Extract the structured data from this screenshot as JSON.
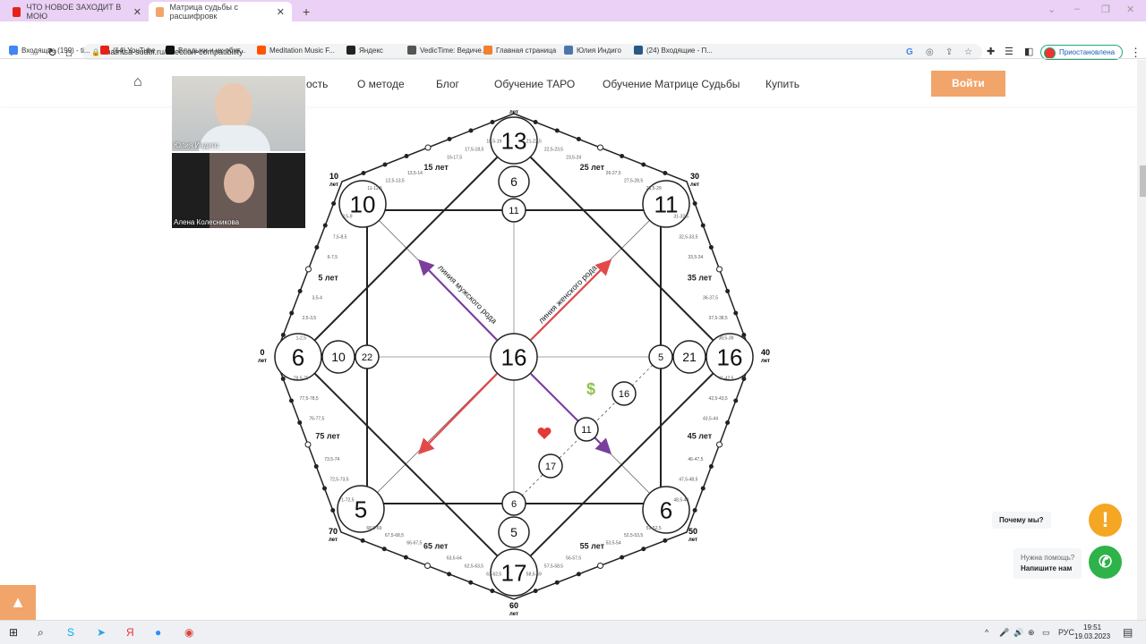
{
  "browser": {
    "tabs": [
      {
        "title": "ЧТО НОВОЕ ЗАХОДИТ В МОЮ",
        "icon": "youtube-icon",
        "color": "#e62117"
      },
      {
        "title": "Матрица судьбы с расшифровк",
        "icon": "site-icon",
        "color": "#f2a56b",
        "active": true
      }
    ],
    "new_tab": "+",
    "url": "matritsa-sudbi.ru/#section-compatibility",
    "profile_status": "Приостановлена",
    "bookmarks": [
      {
        "label": "Входящие (199) - ti...",
        "icon": "gmail-icon",
        "color": "#4285f4"
      },
      {
        "label": "(14) YouTube",
        "icon": "youtube-icon",
        "color": "#e62117"
      },
      {
        "label": "Владыки и их обит...",
        "icon": "t-icon",
        "color": "#111"
      },
      {
        "label": "Meditation Music F...",
        "icon": "soundcloud-icon",
        "color": "#f50"
      },
      {
        "label": "Яндекс",
        "icon": "globe-icon",
        "color": "#222"
      },
      {
        "label": "VedicTime: Ведиче...",
        "icon": "vedic-icon",
        "color": "#555"
      },
      {
        "label": "Главная страница",
        "icon": "home-site-icon",
        "color": "#f08030"
      },
      {
        "label": "Юлия Индиго",
        "icon": "vk-icon",
        "color": "#4a76a8"
      },
      {
        "label": "(24) Входящие - П...",
        "icon": "mail-icon",
        "color": "#2a5885"
      }
    ]
  },
  "site": {
    "nav": [
      "ость",
      "О методе",
      "Блог",
      "Обучение ТАРО",
      "Обучение Матрице Судьбы",
      "Купить"
    ],
    "login": "Войти",
    "accent": "#f2a56b"
  },
  "video": [
    {
      "name": "Юлия Индиго"
    },
    {
      "name": "Алена Колесникова"
    }
  ],
  "matrix": {
    "outer": {
      "top": "13",
      "top_right": "11",
      "right": "16",
      "bottom_right": "6",
      "bottom": "17",
      "bottom_left": "5",
      "left": "6",
      "top_left": "10"
    },
    "center": "16",
    "inner": {
      "top_a": "6",
      "top_b": "11",
      "left_a": "10",
      "left_b": "22",
      "right_a": "5",
      "right_b": "21",
      "bottom_a": "6",
      "bottom_b": "5"
    },
    "extra": {
      "money": "16",
      "love_center": "11",
      "love": "17"
    },
    "male_line": "линия мужского рода",
    "female_line": "линия женского рода",
    "money_symbol": "$",
    "ages": [
      "0",
      "10",
      "20",
      "30",
      "40",
      "50",
      "60",
      "70"
    ],
    "years_word": "лет",
    "edges": [
      [
        "1-2,5",
        "2,5-3,5",
        "3,5-4",
        "5 лет",
        "6-7,5",
        "7,5-8,5",
        "8,5-9"
      ],
      [
        "11-12,5",
        "12,5-13,5",
        "13,5-14",
        "15 лет",
        "16-17,5",
        "17,5-18,5",
        "18,5-19"
      ],
      [
        "21-22,5",
        "22,5-23,5",
        "23,5-24",
        "25 лет",
        "26-27,5",
        "27,5-28,5",
        "28,5-29"
      ],
      [
        "31-32,5",
        "32,5-33,5",
        "33,5-34",
        "35 лет",
        "36-37,5",
        "37,5-38,5",
        "38,5-39"
      ],
      [
        "41-42,5",
        "42,5-43,5",
        "43,5-44",
        "45 лет",
        "46-47,5",
        "47,5-48,5",
        "48,5-49"
      ],
      [
        "51-52,5",
        "52,5-53,5",
        "53,5-54",
        "55 лет",
        "56-57,5",
        "57,5-58,5",
        "58,5-59"
      ],
      [
        "61-62,5",
        "62,5-63,5",
        "63,5-64",
        "65 лет",
        "66-67,5",
        "67,5-68,5",
        "68,5-69"
      ],
      [
        "71-72,5",
        "72,5-73,5",
        "73,5-74",
        "75 лет",
        "76-77,5",
        "77,5-78,5",
        "78,5-79"
      ]
    ],
    "colors": {
      "male": "#7a3f9d",
      "female": "#e24a4a",
      "money": "#8bc34a",
      "heart": "#e53935"
    }
  },
  "widgets": {
    "why": "Почему мы?",
    "help_q": "Нужна помощь?",
    "help_a": "Напишите нам",
    "why_color": "#f5a623",
    "whatsapp_color": "#2eb24a"
  },
  "taskbar": {
    "lang": "РУС",
    "time": "19:51",
    "date": "19.03.2023"
  }
}
